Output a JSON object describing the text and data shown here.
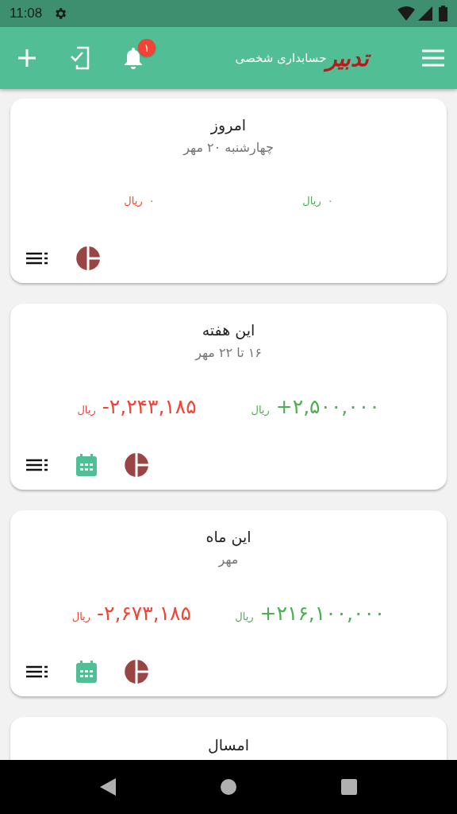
{
  "status_bar": {
    "time": "11:08"
  },
  "app_bar": {
    "logo": "تدبیر",
    "subtitle": "حسابداری شخصی",
    "notification_count": "۱"
  },
  "cards": [
    {
      "kind": "compact",
      "title": "امروز",
      "subtitle": "چهارشنبه ۲۰ مهر",
      "income": {
        "amount": "۰",
        "currency": "ریال"
      },
      "expense": {
        "amount": "۰",
        "currency": "ریال"
      },
      "calendar": false
    },
    {
      "kind": "large",
      "title": "این هفته",
      "subtitle": "۱۶ تا ۲۲ مهر",
      "income": {
        "amount": "+۲,۵۰۰,۰۰۰",
        "currency": "ریال"
      },
      "expense": {
        "amount": "-۲,۲۴۳,۱۸۵",
        "currency": "ریال"
      },
      "calendar": true
    },
    {
      "kind": "large",
      "title": "این ماه",
      "subtitle": "مهر",
      "income": {
        "amount": "+۲۱۶,۱۰۰,۰۰۰",
        "currency": "ریال"
      },
      "expense": {
        "amount": "-۲,۶۷۳,۱۸۵",
        "currency": "ریال"
      },
      "calendar": true
    },
    {
      "kind": "partial",
      "title": "امسال"
    }
  ]
}
